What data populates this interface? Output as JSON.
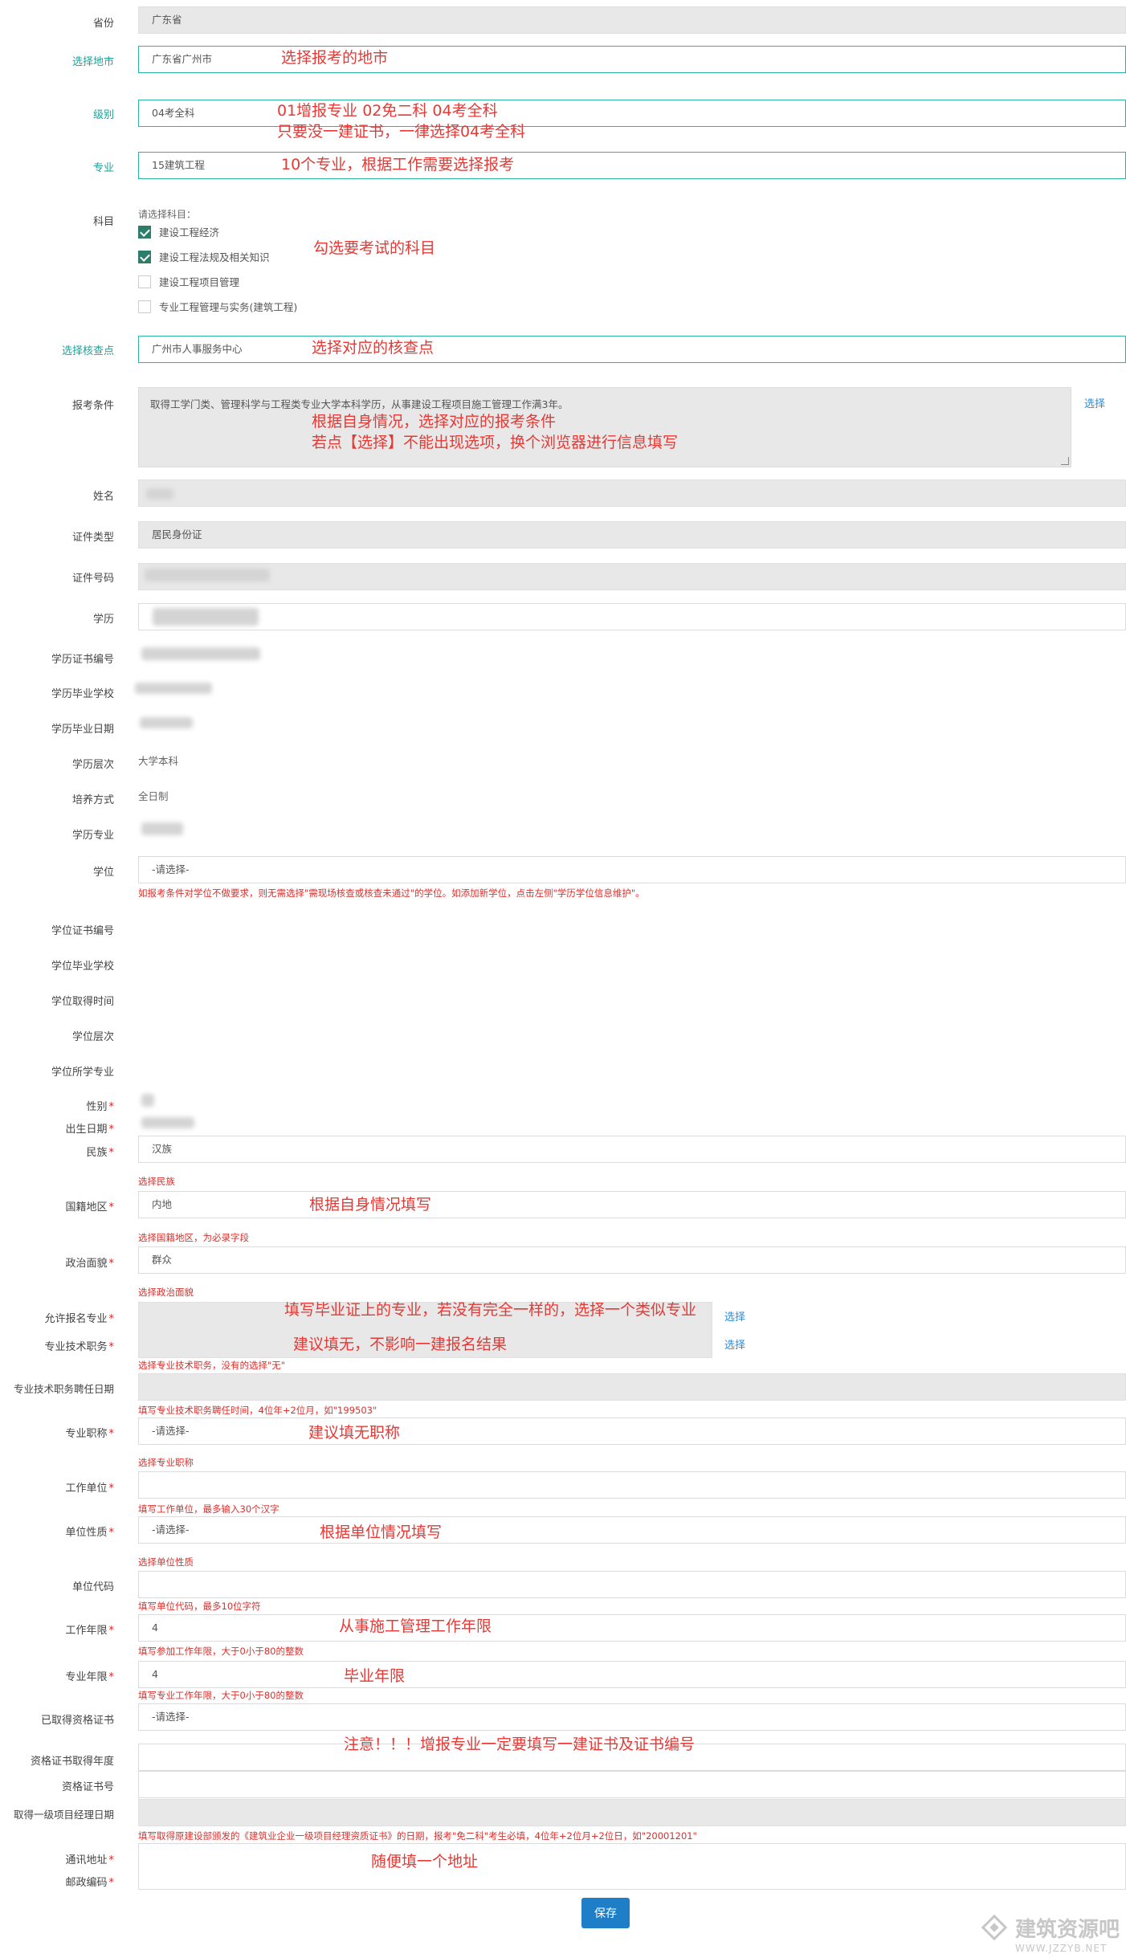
{
  "fields": {
    "province": {
      "label": "省份",
      "value": "广东省"
    },
    "city": {
      "label": "选择地市",
      "value": "广东省广州市"
    },
    "level": {
      "label": "级别",
      "value": "04考全科"
    },
    "major": {
      "label": "专业",
      "value": "15建筑工程"
    },
    "subjects": {
      "label": "科目",
      "prompt": "请选择科目：",
      "options": [
        {
          "label": "建设工程经济",
          "checked": true
        },
        {
          "label": "建设工程法规及相关知识",
          "checked": true
        },
        {
          "label": "建设工程项目管理",
          "checked": false
        },
        {
          "label": "专业工程管理与实务(建筑工程)",
          "checked": false
        }
      ]
    },
    "check_point": {
      "label": "选择核查点",
      "value": "广州市人事服务中心"
    },
    "conditions": {
      "label": "报考条件",
      "value": "取得工学门类、管理科学与工程类专业大学本科学历，从事建设工程项目施工管理工作满3年。",
      "link": "选择"
    },
    "name": {
      "label": "姓名"
    },
    "id_type": {
      "label": "证件类型",
      "value": "居民身份证"
    },
    "id_number": {
      "label": "证件号码"
    },
    "education": {
      "label": "学历"
    },
    "edu_cert_no": {
      "label": "学历证书编号"
    },
    "edu_school": {
      "label": "学历毕业学校"
    },
    "edu_grad_date": {
      "label": "学历毕业日期"
    },
    "edu_level": {
      "label": "学历层次",
      "value": "大学本科"
    },
    "edu_mode": {
      "label": "培养方式",
      "value": "全日制"
    },
    "edu_major": {
      "label": "学历专业"
    },
    "degree": {
      "label": "学位",
      "value": "-请选择-",
      "hint": "如报考条件对学位不做要求，则无需选择\"需现场核查或核查未通过\"的学位。如添加新学位，点击左侧\"学历学位信息维护\"。"
    },
    "degree_cert_no": {
      "label": "学位证书编号"
    },
    "degree_school": {
      "label": "学位毕业学校"
    },
    "degree_date": {
      "label": "学位取得时间"
    },
    "degree_level": {
      "label": "学位层次"
    },
    "degree_major": {
      "label": "学位所学专业"
    },
    "gender": {
      "label": "性别"
    },
    "birth": {
      "label": "出生日期"
    },
    "ethnicity": {
      "label": "民族",
      "value": "汉族",
      "hint": "选择民族"
    },
    "region": {
      "label": "国籍地区",
      "value": "内地",
      "hint": "选择国籍地区，为必录字段"
    },
    "politics": {
      "label": "政治面貌",
      "value": "群众",
      "hint": "选择政治面貌"
    },
    "allowed_major": {
      "label": "允许报名专业",
      "link": "选择"
    },
    "title": {
      "label": "专业技术职务",
      "link": "选择",
      "hint": "选择专业技术职务，没有的选择\"无\""
    },
    "title_date": {
      "label": "专业技术职务聘任日期",
      "hint": "填写专业技术职务聘任时间，4位年+2位月，如\"199503\""
    },
    "prof_title": {
      "label": "专业职称",
      "value": "-请选择-",
      "hint": "选择专业职称"
    },
    "employer": {
      "label": "工作单位",
      "hint": "填写工作单位，最多输入30个汉字"
    },
    "unit_type": {
      "label": "单位性质",
      "value": "-请选择-",
      "hint": "选择单位性质"
    },
    "unit_code": {
      "label": "单位代码",
      "hint": "填写单位代码，最多10位字符"
    },
    "work_years": {
      "label": "工作年限",
      "value": "4",
      "hint": "填写参加工作年限，大于0小于80的整数"
    },
    "major_years": {
      "label": "专业年限",
      "value": "4",
      "hint": "填写专业工作年限，大于0小于80的整数"
    },
    "obtained_cert": {
      "label": "已取得资格证书",
      "value": "-请选择-"
    },
    "cert_year": {
      "label": "资格证书取得年度"
    },
    "cert_no": {
      "label": "资格证书号"
    },
    "pm_date": {
      "label": "取得一级项目经理日期",
      "hint": "填写取得原建设部颁发的《建筑业企业一级项目经理资质证书》的日期，报考\"免二科\"考生必填，4位年+2位月+2位日，如\"20001201\""
    },
    "address": {
      "label": "通讯地址"
    },
    "postcode": {
      "label": "邮政编码"
    }
  },
  "annotations": {
    "city": "选择报考的地市",
    "level_1": "01增报专业  02免二科  04考全科",
    "level_2": "只要没一建证书，一律选择04考全科",
    "major": "10个专业，根据工作需要选择报考",
    "subjects": "勾选要考试的科目",
    "check_point": "选择对应的核查点",
    "conditions_1": "根据自身情况，选择对应的报考条件",
    "conditions_2": "若点【选择】不能出现选项，换个浏览器进行信息填写",
    "region": "根据自身情况填写",
    "allowed_major": "填写毕业证上的专业，若没有完全一样的，选择一个类似专业",
    "title": "建议填无，不影响一建报名结果",
    "prof_title": "建议填无职称",
    "unit_type": "根据单位情况填写",
    "work_years": "从事施工管理工作年限",
    "major_years": "毕业年限",
    "cert": "注意！！！增报专业一定要填写一建证书及证书编号",
    "address": "随便填一个地址"
  },
  "save_label": "保存",
  "watermark": {
    "title": "建筑资源吧",
    "url": "WWW.JZZYB.NET"
  }
}
